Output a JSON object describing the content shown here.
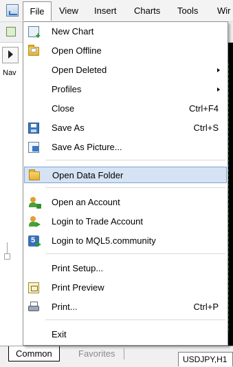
{
  "menubar": {
    "items": [
      "File",
      "View",
      "Insert",
      "Charts",
      "Tools",
      "Wir"
    ]
  },
  "navigator": {
    "label": "Nav"
  },
  "file_menu": {
    "items": [
      {
        "label": "New Chart",
        "icon": "new-chart-icon",
        "shortcut": "",
        "submenu": false
      },
      {
        "label": "Open Offline",
        "icon": "open-folder-icon",
        "shortcut": "",
        "submenu": false
      },
      {
        "label": "Open Deleted",
        "icon": "",
        "shortcut": "",
        "submenu": true
      },
      {
        "label": "Profiles",
        "icon": "",
        "shortcut": "",
        "submenu": true
      },
      {
        "label": "Close",
        "icon": "",
        "shortcut": "Ctrl+F4",
        "submenu": false
      },
      {
        "label": "Save As",
        "icon": "save-icon",
        "shortcut": "Ctrl+S",
        "submenu": false
      },
      {
        "label": "Save As Picture...",
        "icon": "picture-icon",
        "shortcut": "",
        "submenu": false
      },
      {
        "label": "Open Data Folder",
        "icon": "folder-icon",
        "shortcut": "",
        "submenu": false,
        "highlighted": true
      },
      {
        "label": "Open an Account",
        "icon": "add-account-icon",
        "shortcut": "",
        "submenu": false
      },
      {
        "label": "Login to Trade Account",
        "icon": "login-icon",
        "shortcut": "",
        "submenu": false
      },
      {
        "label": "Login to MQL5.community",
        "icon": "mql5-icon",
        "shortcut": "",
        "submenu": false
      },
      {
        "label": "Print Setup...",
        "icon": "",
        "shortcut": "",
        "submenu": false
      },
      {
        "label": "Print Preview",
        "icon": "print-preview-icon",
        "shortcut": "",
        "submenu": false
      },
      {
        "label": "Print...",
        "icon": "printer-icon",
        "shortcut": "Ctrl+P",
        "submenu": false
      },
      {
        "label": "Exit",
        "icon": "",
        "shortcut": "",
        "submenu": false
      }
    ]
  },
  "bottom_tabs": {
    "common": "Common",
    "favorites": "Favorites",
    "chart_tab": "USDJPY,H1"
  },
  "colors": {
    "highlight_bg": "#d5e3f4",
    "highlight_border": "#7aa5d6"
  }
}
